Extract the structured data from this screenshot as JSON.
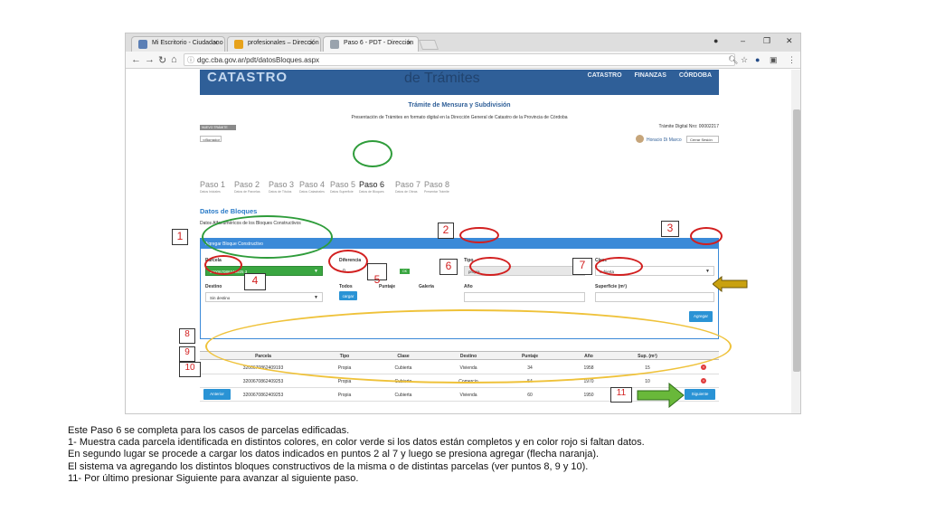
{
  "browser": {
    "tabs": [
      {
        "label": "Mi Escritorio - Ciudadano",
        "favicon_color": "#5b7fb5"
      },
      {
        "label": "profesionales – Dirección",
        "favicon_color": "#e7a21b"
      },
      {
        "label": "Paso 6 - PDT - Dirección",
        "favicon_color": "#9aa3ad"
      }
    ],
    "url": "dgc.cba.gov.ar/pdt/datosBloques.aspx",
    "window_controls": {
      "minimize": "–",
      "restore": "❐",
      "close": "✕"
    }
  },
  "banner": {
    "left_text": "CATASTRO",
    "title": "de Trámites",
    "logos": [
      "CATASTRO",
      "FINANZAS",
      "CÓRDOBA"
    ],
    "colors": {
      "bg": "#2f5f98"
    }
  },
  "header": {
    "tramite_title": "Trámite de Mensura y Subdivisión",
    "subtitle": "Presentación de Trámites en formato digital en la Dirección General de Catastro de la Provincia de Córdoba",
    "badge": "NUEVO TRÁMITE",
    "tramite_digital": "Trámite Digital Nro: 00002217",
    "back_label": "Borrador",
    "user_name": "Horacio Di Marco",
    "logout_label": "Cerrar Sesión"
  },
  "steps": [
    {
      "label": "Paso 1",
      "sub": "Datos Iniciales"
    },
    {
      "label": "Paso 2",
      "sub": "Datos de Parcelas"
    },
    {
      "label": "Paso 3",
      "sub": "Datos de Títulos"
    },
    {
      "label": "Paso 4",
      "sub": "Datos Catastrales"
    },
    {
      "label": "Paso 5",
      "sub": "Datos Superficie"
    },
    {
      "label": "Paso 6",
      "sub": "Datos de Bloques"
    },
    {
      "label": "Paso 7",
      "sub": "Datos de Obras"
    },
    {
      "label": "Paso 8",
      "sub": "Presentar Trámite"
    }
  ],
  "section": {
    "title": "Datos de Bloques",
    "subtitle": "Datos Alfanuméricos de los Bloques Constructivos"
  },
  "form": {
    "panel_title": "Agregar Bloque Constructivo",
    "parcela_label": "Parcela",
    "parcela_value": "320067086240925 3",
    "diferencia_label": "Diferencia",
    "diferencia_value": "0",
    "ok_badge": "OK",
    "tipo_label": "Tipo",
    "tipo_value": "propia",
    "clase_label": "Clase",
    "clase_value": "cubierta",
    "destino_label": "Destino",
    "destino_value": "Sin destino",
    "todos_label": "Todos",
    "cargar_label": "cargar",
    "puntaje_label": "Puntaje",
    "galeria_label": "Galería",
    "anio_label": "Año",
    "superficie_label": "Superficie (m²)",
    "agregar_label": "Agregar"
  },
  "table": {
    "headers": [
      "Parcela",
      "Tipo",
      "Clase",
      "Destino",
      "Puntaje",
      "Año",
      "Sup. (m²)"
    ],
    "rows": [
      [
        "3200670862409193",
        "Propia",
        "Cubierta",
        "Vivienda",
        "34",
        "1958",
        "15"
      ],
      [
        "3200670862409253",
        "Propia",
        "Cubierta",
        "Comercio",
        "54",
        "1970",
        "10"
      ],
      [
        "3200670862409253",
        "Propia",
        "Cubierta",
        "Vivienda",
        "60",
        "1950",
        "15"
      ]
    ]
  },
  "footer": {
    "anterior_label": "Anterior",
    "siguiente_label": "Siguiente"
  },
  "annotations": [
    "1",
    "2",
    "3",
    "4",
    "5",
    "6",
    "7",
    "8",
    "9",
    "10",
    "11"
  ],
  "description": [
    "Este Paso 6 se completa para los casos de parcelas edificadas.",
    "1- Muestra cada parcela identificada en distintos colores, en color verde si los datos están completos y en color rojo si faltan datos.",
    "En segundo lugar se procede a cargar los datos indicados en puntos 2 al 7 y luego se presiona agregar (flecha naranja).",
    "El sistema va agregando los distintos bloques constructivos de la misma o de distintas parcelas (ver puntos 8, 9 y 10).",
    "11- Por último presionar Siguiente para avanzar al siguiente paso."
  ],
  "colors": {
    "accent": "#3b8ad8",
    "ok_green": "#3aa641",
    "annot_red": "#d21f1f",
    "annot_yellow": "#efc23a",
    "annot_green": "#2e9c3a",
    "arrow_orange": "#c9a10f"
  }
}
